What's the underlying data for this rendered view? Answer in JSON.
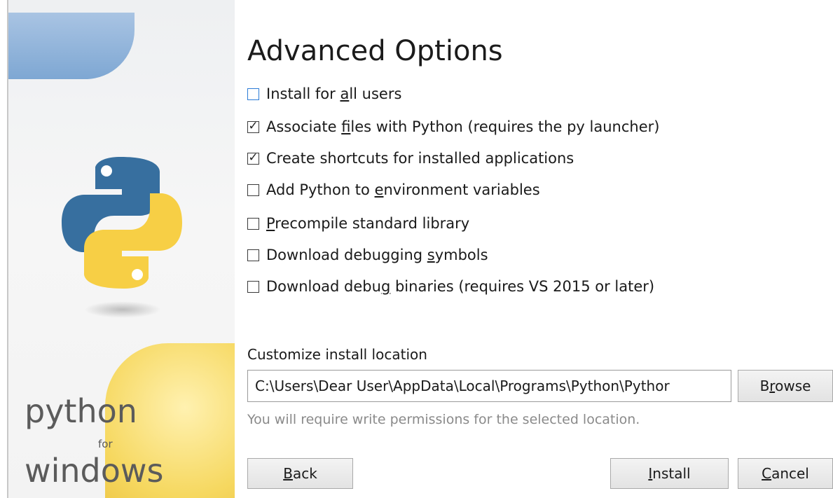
{
  "sidebar": {
    "brand_line1": "python",
    "brand_line2": "for",
    "brand_line3": "windows",
    "logo_colors": {
      "blue": "#376f9f",
      "yellow": "#f7cf45"
    }
  },
  "title": "Advanced Options",
  "options": [
    {
      "pre": "Install for ",
      "key": "a",
      "post": "ll users",
      "checked": false,
      "focused": true
    },
    {
      "pre": "Associate ",
      "key": "f",
      "post": "iles with Python (requires the py launcher)",
      "checked": true,
      "focused": false
    },
    {
      "pre": "Create shortcuts for installed applications",
      "key": "",
      "post": "",
      "checked": true,
      "focused": false
    },
    {
      "pre": "Add Python to ",
      "key": "e",
      "post": "nvironment variables",
      "checked": false,
      "focused": false
    },
    {
      "pre": "",
      "key": "P",
      "post": "recompile standard library",
      "checked": false,
      "focused": false
    },
    {
      "pre": "Download debugging ",
      "key": "s",
      "post": "ymbols",
      "checked": false,
      "focused": false
    },
    {
      "pre": "Download debu",
      "key": "g",
      "post": " binaries (requires VS 2015 or later)",
      "checked": false,
      "focused": false
    }
  ],
  "location": {
    "label": "Customize install location",
    "path": "C:\\Users\\Dear User\\AppData\\Local\\Programs\\Python\\Pythor",
    "hint": "You will require write permissions for the selected location."
  },
  "buttons": {
    "browse": {
      "pre": "B",
      "key": "r",
      "post": "owse"
    },
    "back": {
      "pre": "",
      "key": "B",
      "post": "ack"
    },
    "install": {
      "pre": "",
      "key": "I",
      "post": "nstall"
    },
    "cancel": {
      "pre": "",
      "key": "C",
      "post": "ancel"
    }
  },
  "check_glyph": "☑"
}
